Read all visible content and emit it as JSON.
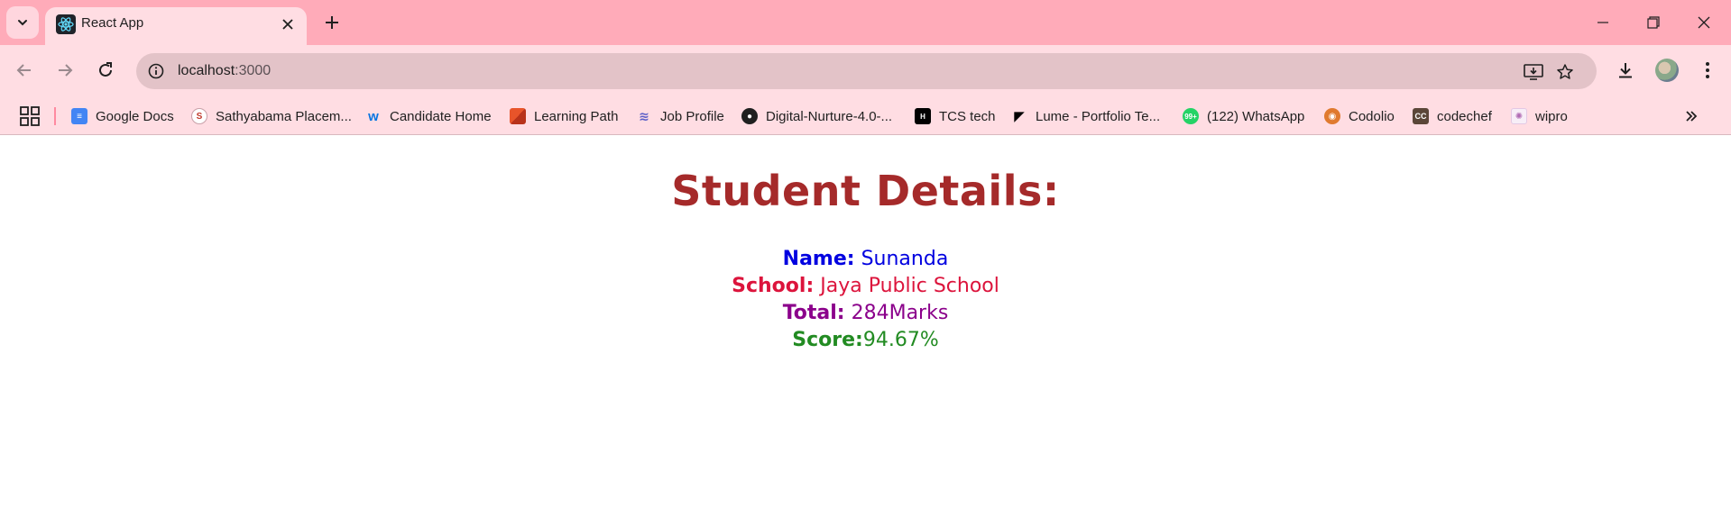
{
  "browser": {
    "tab_title": "React App",
    "url_host": "localhost",
    "url_port": ":3000"
  },
  "bookmarks": [
    {
      "label": "Google Docs",
      "icon": "google-docs-icon",
      "color": "#4285f4"
    },
    {
      "label": "Sathyabama Placem...",
      "icon": "sathyabama-icon",
      "color": "#c0392b"
    },
    {
      "label": "Candidate Home",
      "icon": "workday-icon",
      "color": "#f5a623"
    },
    {
      "label": "Learning Path",
      "icon": "learning-path-icon",
      "color": "#d9481a"
    },
    {
      "label": "Job Profile",
      "icon": "job-profile-icon",
      "color": "#5b5fc7"
    },
    {
      "label": "Digital-Nurture-4.0-...",
      "icon": "github-icon",
      "color": "#1f1f1f"
    },
    {
      "label": "TCS tech",
      "icon": "tcs-icon",
      "color": "#000000"
    },
    {
      "label": "Lume - Portfolio Te...",
      "icon": "framer-icon",
      "color": "#000000"
    },
    {
      "label": "(122) WhatsApp",
      "icon": "whatsapp-icon",
      "color": "#25d366"
    },
    {
      "label": "Codolio",
      "icon": "codolio-icon",
      "color": "#e07a2f"
    },
    {
      "label": "codechef",
      "icon": "codechef-icon",
      "color": "#5b4638"
    },
    {
      "label": "wipro",
      "icon": "wipro-icon",
      "color": "#b06ab3"
    }
  ],
  "page": {
    "heading": "Student Details:",
    "name_label": "Name:",
    "name_value": "Sunanda",
    "school_label": "School:",
    "school_value": "Jaya Public School",
    "total_label": "Total:",
    "total_value": "284Marks",
    "score_label": "Score:",
    "score_value": "94.67%"
  },
  "colors": {
    "heading": "#a52a2a",
    "name": "#0000e0",
    "school": "#dc143c",
    "total": "#8b008b",
    "score": "#228b22",
    "browser_accent": "#ffabb9"
  }
}
